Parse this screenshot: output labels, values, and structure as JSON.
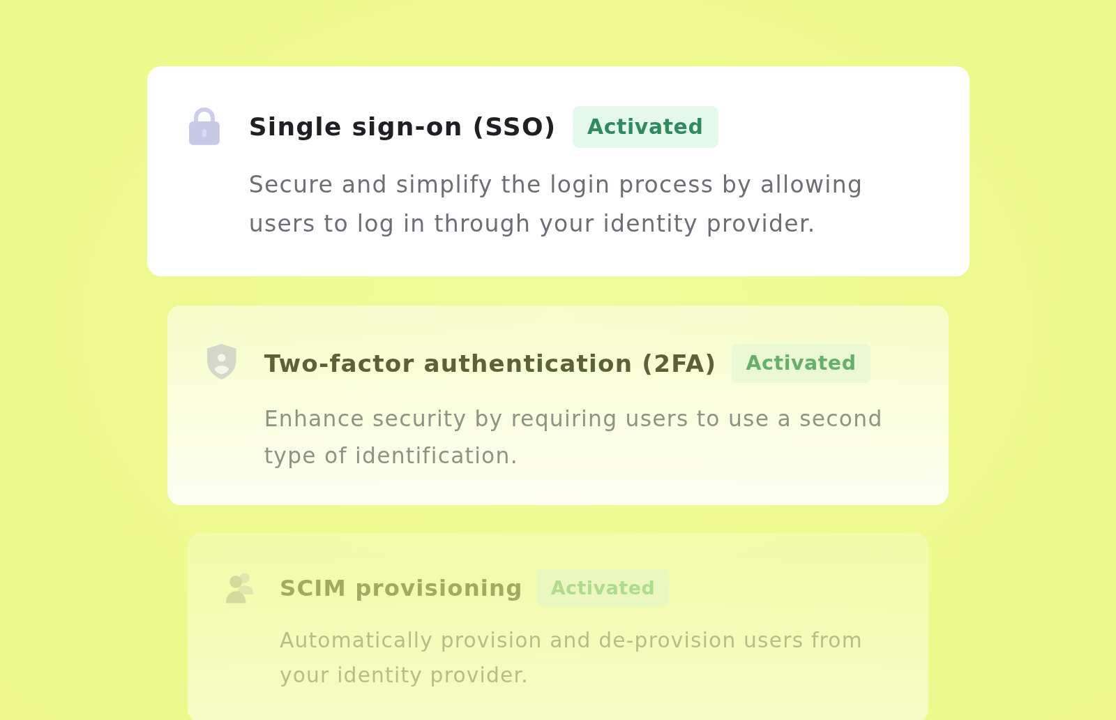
{
  "cards": [
    {
      "kind": "sso",
      "title": "Single sign-on (SSO)",
      "badge": "Activated",
      "description": "Secure and simplify the login process by allowing users to log in through your identity provider."
    },
    {
      "kind": "mfa",
      "title": "Two-factor authentication (2FA)",
      "badge": "Activated",
      "description": "Enhance security by requiring users to use a second type of identification."
    },
    {
      "kind": "scim",
      "title": "SCIM provisioning",
      "badge": "Activated",
      "description": "Automatically provision and de-provision users from your identity provider."
    }
  ]
}
